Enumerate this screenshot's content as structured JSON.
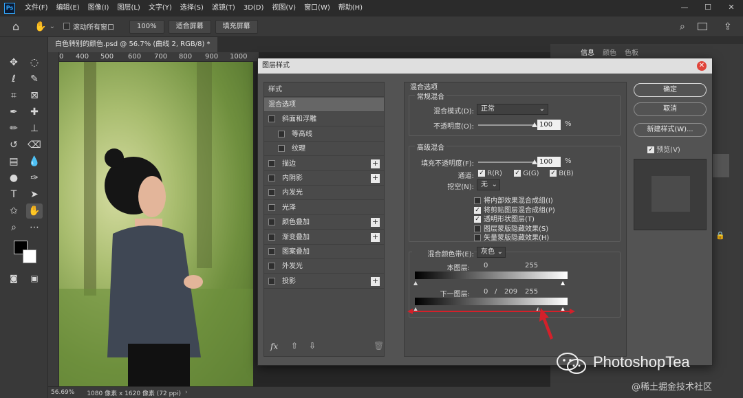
{
  "app": {
    "logo": "Ps",
    "menu": [
      "文件(F)",
      "编辑(E)",
      "图像(I)",
      "图层(L)",
      "文字(Y)",
      "选择(S)",
      "滤镜(T)",
      "3D(D)",
      "视图(V)",
      "窗口(W)",
      "帮助(H)"
    ],
    "window_controls": [
      "—",
      "☐",
      "✕"
    ]
  },
  "options_bar": {
    "scroll_all_label": "滚动所有窗口",
    "zoom_btn": "100%",
    "fit_screen_btn": "适合屏幕",
    "fill_screen_btn": "填充屏幕"
  },
  "document": {
    "tab_title": "白色转别的颜色.psd @ 56.7% (曲线 2, RGB/8) *",
    "ruler_ticks": [
      "0",
      "400",
      "500",
      "600",
      "700",
      "800",
      "900",
      "1000"
    ],
    "status_zoom": "56.69%",
    "status_info": "1080 像素 x 1620 像素 (72 ppi)"
  },
  "right_panel": {
    "tabs": [
      "信息",
      "颜色",
      "色板"
    ]
  },
  "dialog": {
    "title": "图层样式",
    "styles_header": "样式",
    "style_items": [
      {
        "label": "混合选项",
        "checkbox": false,
        "plus": false,
        "selected": true,
        "indent": false
      },
      {
        "label": "斜面和浮雕",
        "checkbox": true,
        "plus": false,
        "selected": false,
        "indent": false
      },
      {
        "label": "等高线",
        "checkbox": true,
        "plus": false,
        "selected": false,
        "indent": true
      },
      {
        "label": "纹理",
        "checkbox": true,
        "plus": false,
        "selected": false,
        "indent": true
      },
      {
        "label": "描边",
        "checkbox": true,
        "plus": true,
        "selected": false,
        "indent": false
      },
      {
        "label": "内阴影",
        "checkbox": true,
        "plus": true,
        "selected": false,
        "indent": false
      },
      {
        "label": "内发光",
        "checkbox": true,
        "plus": false,
        "selected": false,
        "indent": false
      },
      {
        "label": "光泽",
        "checkbox": true,
        "plus": false,
        "selected": false,
        "indent": false
      },
      {
        "label": "颜色叠加",
        "checkbox": true,
        "plus": true,
        "selected": false,
        "indent": false
      },
      {
        "label": "渐变叠加",
        "checkbox": true,
        "plus": true,
        "selected": false,
        "indent": false
      },
      {
        "label": "图案叠加",
        "checkbox": true,
        "plus": false,
        "selected": false,
        "indent": false
      },
      {
        "label": "外发光",
        "checkbox": true,
        "plus": false,
        "selected": false,
        "indent": false
      },
      {
        "label": "投影",
        "checkbox": true,
        "plus": true,
        "selected": false,
        "indent": false
      }
    ],
    "fx_label": "fx",
    "blend_options": {
      "section_title": "混合选项",
      "general_title": "常规混合",
      "blend_mode_label": "混合模式(D):",
      "blend_mode_value": "正常",
      "opacity_label": "不透明度(O):",
      "opacity_value": "100",
      "opacity_fraction": 1.0,
      "percent": "%",
      "advanced_title": "高级混合",
      "fill_opacity_label": "填充不透明度(F):",
      "fill_opacity_value": "100",
      "fill_opacity_fraction": 1.0,
      "channels_label": "通道:",
      "channel_r": "R(R)",
      "channel_g": "G(G)",
      "channel_b": "B(B)",
      "knockout_label": "挖空(N):",
      "knockout_value": "无",
      "options": [
        {
          "label": "将内部效果混合成组(I)",
          "checked": false
        },
        {
          "label": "将剪贴图层混合成组(P)",
          "checked": true
        },
        {
          "label": "透明形状图层(T)",
          "checked": true
        },
        {
          "label": "图层蒙版隐藏效果(S)",
          "checked": false
        },
        {
          "label": "矢量蒙版隐藏效果(H)",
          "checked": false
        }
      ],
      "blend_if_label": "混合颜色带(E):",
      "blend_if_value": "灰色",
      "this_layer_label": "本图层:",
      "this_layer_low": "0",
      "this_layer_high": "255",
      "underlying_label": "下一图层:",
      "underlying_low": "0",
      "underlying_sep": "/",
      "underlying_split": "209",
      "underlying_high": "255"
    },
    "buttons": {
      "ok": "确定",
      "cancel": "取消",
      "new_style": "新建样式(W)...",
      "preview": "预览(V)"
    }
  },
  "watermark": {
    "brand": "PhotoshopTea",
    "site": "@稀土掘金技术社区"
  },
  "colors": {
    "accent_red": "#d4202a",
    "dialog_bg": "#535353"
  }
}
